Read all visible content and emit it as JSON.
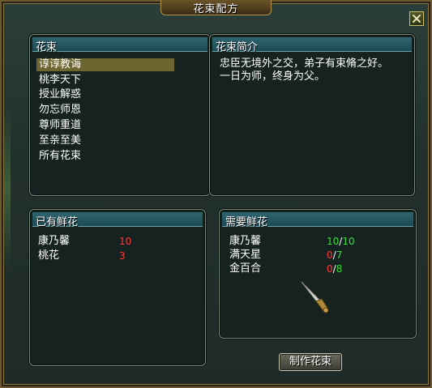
{
  "window": {
    "title": "花束配方"
  },
  "bouquet_list": {
    "header": "花束",
    "items": [
      "谆谆教诲",
      "桃李天下",
      "授业解惑",
      "勿忘师恩",
      "尊师重道",
      "至亲至美",
      "所有花束"
    ],
    "selected_index": 0
  },
  "description": {
    "header": "花束简介",
    "line1": "忠臣无境外之交，弟子有束脩之好。",
    "line2": "一日为师，终身为父。"
  },
  "owned_flowers": {
    "header": "已有鲜花",
    "items": [
      {
        "name": "康乃馨",
        "count": "10"
      },
      {
        "name": "桃花",
        "count": "3"
      }
    ]
  },
  "required_flowers": {
    "header": "需要鲜花",
    "items": [
      {
        "name": "康乃馨",
        "have": "10",
        "sep": "/",
        "need": "10"
      },
      {
        "name": "满天星",
        "have": "0",
        "sep": "/",
        "need": "7"
      },
      {
        "name": "金百合",
        "have": "0",
        "sep": "/",
        "need": "8"
      }
    ]
  },
  "actions": {
    "make_label": "制作花束"
  },
  "icons": {
    "close": "close-icon",
    "cursor": "dagger-cursor-icon"
  },
  "colors": {
    "accent_header": "#2f6670",
    "count_red": "#ff3a3a",
    "count_green": "#38e038",
    "selected_row": "#6e6630"
  }
}
